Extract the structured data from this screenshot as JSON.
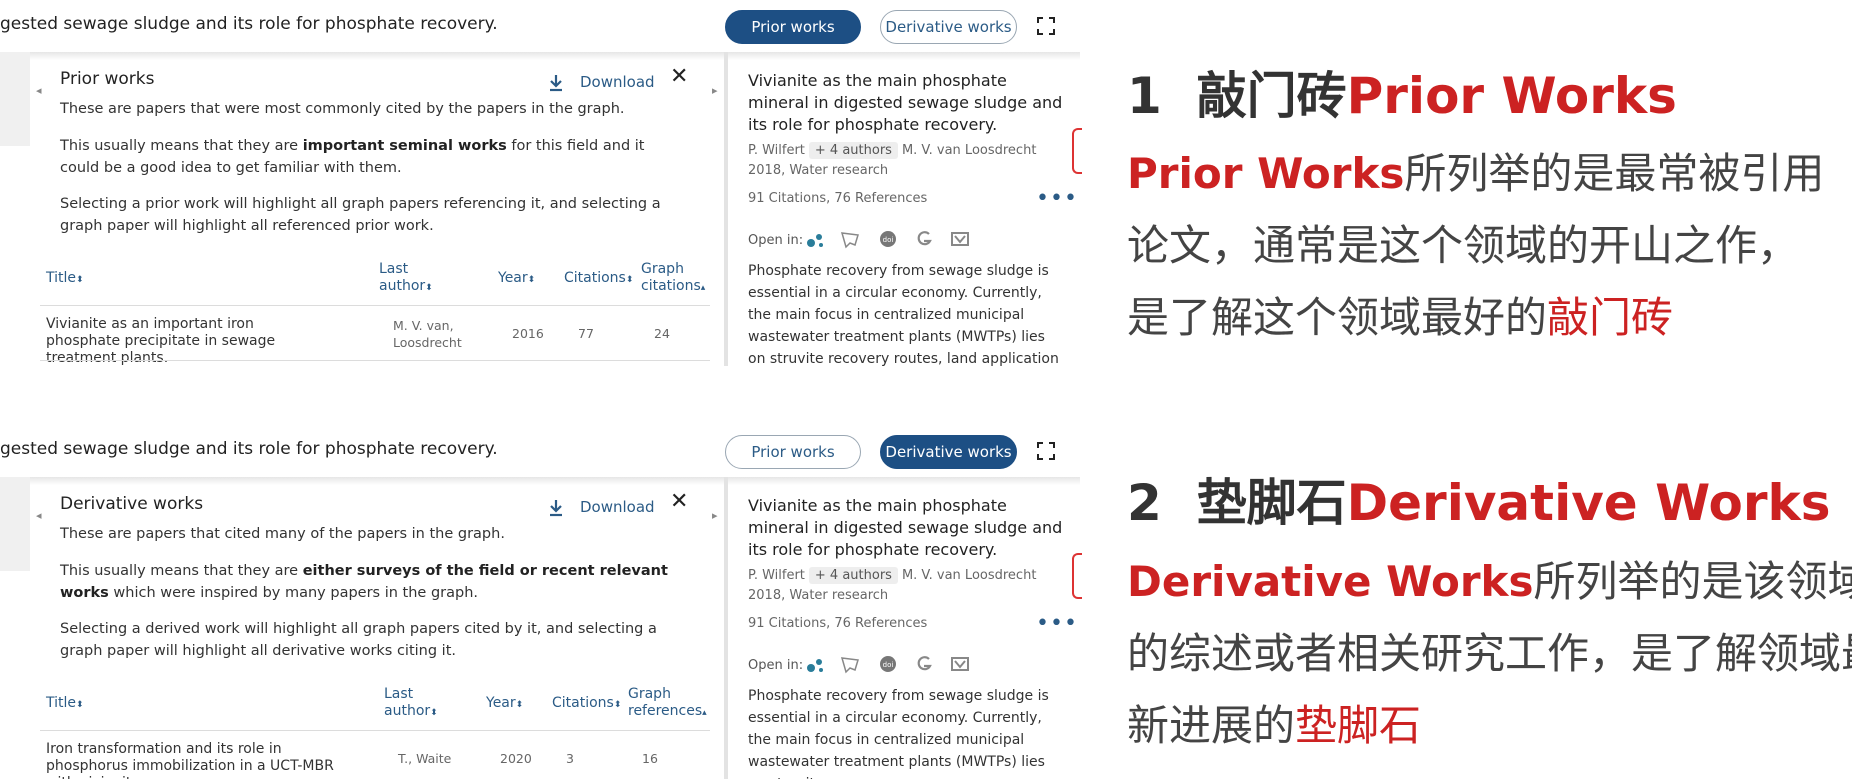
{
  "panels": [
    {
      "paper_title_truncated": "gested sewage sludge and its role for phosphate recovery.",
      "tabs": {
        "prior": "Prior works",
        "derivative": "Derivative works"
      },
      "active_tab": "prior",
      "section_title": "Prior works",
      "download_label": "Download",
      "desc1": "These are papers that were most commonly cited by the papers in the graph.",
      "desc2_pre": "This usually means that they are ",
      "desc2_bold": "important seminal works",
      "desc2_post": " for this field and it could be a good idea to get familiar with them.",
      "desc3": "Selecting a prior work will highlight all graph papers referencing it, and selecting a graph paper will highlight all referenced prior work.",
      "table": {
        "headers": [
          "Title",
          "Last author",
          "Year",
          "Citations",
          "Graph citations"
        ],
        "row": {
          "title": "Vivianite as an important iron phosphate precipitate in sewage treatment plants.",
          "author": "M. V. van, Loosdrecht",
          "year": "2016",
          "citations": "77",
          "graph": "24"
        }
      }
    },
    {
      "paper_title_truncated": "gested sewage sludge and its role for phosphate recovery.",
      "tabs": {
        "prior": "Prior works",
        "derivative": "Derivative works"
      },
      "active_tab": "derivative",
      "section_title": "Derivative works",
      "download_label": "Download",
      "desc1": "These are papers that cited many of the papers in the graph.",
      "desc2_pre": "This usually means that they are ",
      "desc2_bold": "either surveys of the field or recent relevant works",
      "desc2_post": " which were inspired by many papers in the graph.",
      "desc3": "Selecting a derived work will highlight all graph papers cited by it, and selecting a graph paper will highlight all derivative works citing it.",
      "table": {
        "headers": [
          "Title",
          "Last author",
          "Year",
          "Citations",
          "Graph references"
        ],
        "row": {
          "title": "Iron transformation and its role in phosphorus immobilization in a UCT-MBR with vivianite…",
          "author": "T., Waite",
          "year": "2020",
          "citations": "3",
          "graph": "16"
        }
      }
    }
  ],
  "paper": {
    "title": "Vivianite as the main phosphate mineral in digested sewage sludge and its role for phosphate recovery.",
    "first_author": "P. Wilfert",
    "more_authors": "+ 4 authors",
    "last_author": "M. V. van Loosdrecht",
    "year_venue": "2018, Water research",
    "stats": "91 Citations, 76 References",
    "open_in_label": "Open in:",
    "abstract_panel1": "Phosphate recovery from sewage sludge is essential in a circular economy. Currently, the main focus in centralized municipal wastewater treatment plants (MWTPs) lies on struvite recovery routes, land application of sludge or on",
    "abstract_panel2": "Phosphate recovery from sewage sludge is essential in a circular economy. Currently, the main focus in centralized municipal wastewater treatment plants (MWTPs) lies on struvite"
  },
  "notes": {
    "one": {
      "num": "1",
      "cn_title": "敲门砖",
      "en_title": "Prior Works",
      "line1_en": "Prior Works",
      "line1_cn": "所列举的是最常被引用",
      "line2": "论文，通常是这个领域的开山之作，",
      "line3_pre": "是了解这个领域最好的",
      "line3_red": "敲门砖"
    },
    "two": {
      "num": "2",
      "cn_title": "垫脚石",
      "en_title": "Derivative Works",
      "line1_en": "Derivative Works",
      "line1_cn": "所列举的是该领域新",
      "line2": "的综述或者相关研究工作，是了解领域最",
      "line3_pre": "新进展的",
      "line3_red": "垫脚石"
    }
  },
  "colors": {
    "accent": "#1d4f84",
    "link": "#2b5b86",
    "highlight": "#cc2222"
  }
}
